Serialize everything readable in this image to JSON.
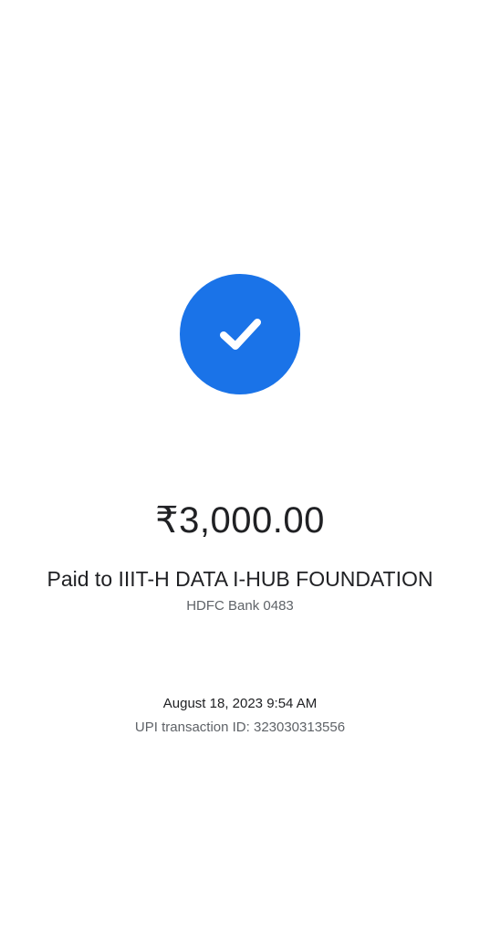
{
  "payment": {
    "status_icon": "check-icon",
    "amount": "₹3,000.00",
    "payee_line": "Paid to IIIT-H DATA I-HUB FOUNDATION",
    "bank_line": "HDFC Bank 0483",
    "datetime": "August 18, 2023 9:54 AM",
    "transaction_line": "UPI transaction ID: 323030313556"
  },
  "colors": {
    "accent": "#1a73e8",
    "text_primary": "#202124",
    "text_secondary": "#5f6368",
    "background": "#ffffff"
  }
}
